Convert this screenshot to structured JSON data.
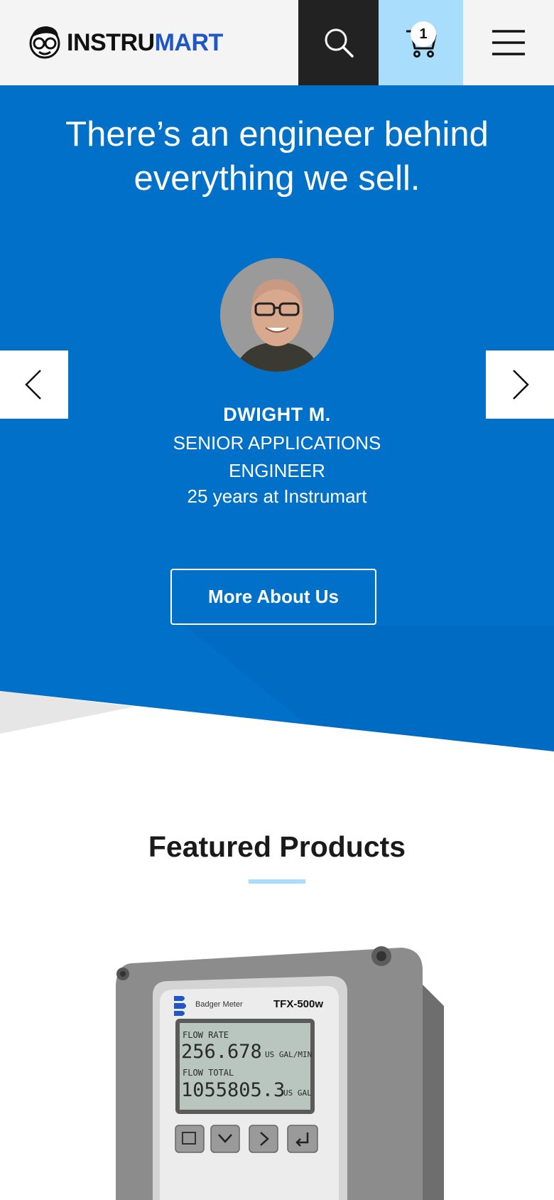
{
  "header": {
    "logo_part1": "INSTRU",
    "logo_part2": "MART",
    "cart_count": "1"
  },
  "hero": {
    "title": "There’s an engineer behind everything we sell.",
    "person": {
      "name": "DWIGHT M.",
      "role": "SENIOR APPLICATIONS ENGINEER",
      "tenure": "25 years at Instrumart"
    },
    "cta_label": "More About Us"
  },
  "featured": {
    "title": "Featured Products",
    "product": {
      "brand": "Badger Meter",
      "model": "TFX-500w",
      "flow_rate_label": "FLOW RATE",
      "flow_rate_value": "256.678",
      "flow_rate_unit": "US GAL/MIN",
      "flow_total_label": "FLOW TOTAL",
      "flow_total_value": "1055805.3",
      "flow_total_unit": "US GAL"
    }
  },
  "colors": {
    "brand_blue": "#0070c9",
    "cart_bg": "#a8ddfb",
    "search_bg": "#222222",
    "accent_underline": "#a8ddfb"
  }
}
